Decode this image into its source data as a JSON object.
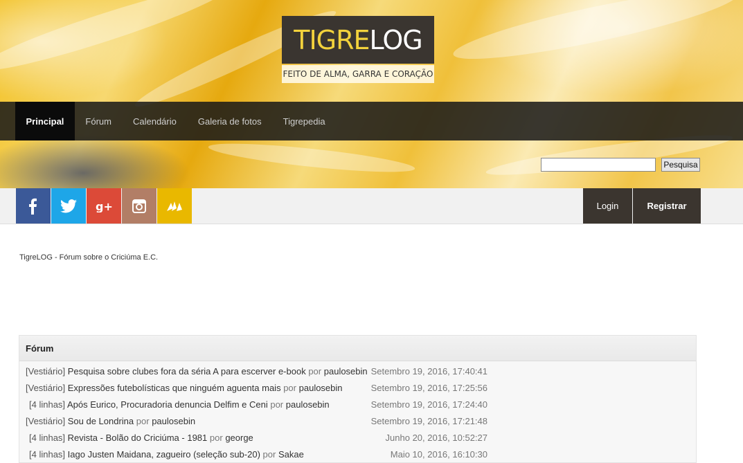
{
  "header": {
    "logo_tigre": "TIGRE",
    "logo_log": "LOG",
    "tagline": "FEITO DE ALMA, GARRA E CORAÇÃO"
  },
  "nav": {
    "items": [
      {
        "label": "Principal",
        "active": true
      },
      {
        "label": "Fórum",
        "active": false
      },
      {
        "label": "Calendário",
        "active": false
      },
      {
        "label": "Galeria de fotos",
        "active": false
      },
      {
        "label": "Tigrepedia",
        "active": false
      }
    ]
  },
  "search": {
    "value": "",
    "button_label": "Pesquisa"
  },
  "social": [
    {
      "icon": "facebook-icon",
      "glyph": "f",
      "color": "#3b5998"
    },
    {
      "icon": "twitter-icon",
      "glyph": "🐦",
      "color": "#1da1f2"
    },
    {
      "icon": "google-plus-icon",
      "glyph": "g+",
      "color": "#dd4b39"
    },
    {
      "icon": "instagram-icon",
      "glyph": "◙",
      "color": "#b07d62"
    },
    {
      "icon": "site-icon",
      "glyph": "⋙",
      "color": "#e6b400"
    }
  ],
  "auth": {
    "login_label": "Login",
    "register_label": "Registrar"
  },
  "breadcrumb": "TigreLOG - Fórum sobre o Criciúma E.C.",
  "forum": {
    "title": "Fórum",
    "por": "por",
    "rows": [
      {
        "category": "[Vestiário]",
        "topic": "Pesquisa sobre clubes fora da séria A para escerver e-book",
        "author": "paulosebin",
        "date": "Setembro 19, 2016, 17:40:41"
      },
      {
        "category": "[Vestiário]",
        "topic": "Expressões futebolísticas que ninguém aguenta mais",
        "author": "paulosebin",
        "date": "Setembro 19, 2016, 17:25:56"
      },
      {
        "category": "[4 linhas]",
        "topic": "Após Eurico, Procuradoria denuncia Delfim e Ceni",
        "author": "paulosebin",
        "date": "Setembro 19, 2016, 17:24:40"
      },
      {
        "category": "[Vestiário]",
        "topic": "Sou de Londrina",
        "author": "paulosebin",
        "date": "Setembro 19, 2016, 17:21:48"
      },
      {
        "category": "[4 linhas]",
        "topic": "Revista - Bolão do Criciúma - 1981",
        "author": "george",
        "date": "Junho 20, 2016, 10:52:27"
      },
      {
        "category": "[4 linhas]",
        "topic": "Iago Justen Maidana, zagueiro (seleção sub-20)",
        "author": "Sakae",
        "date": "Maio 10, 2016, 16:10:30"
      }
    ]
  }
}
